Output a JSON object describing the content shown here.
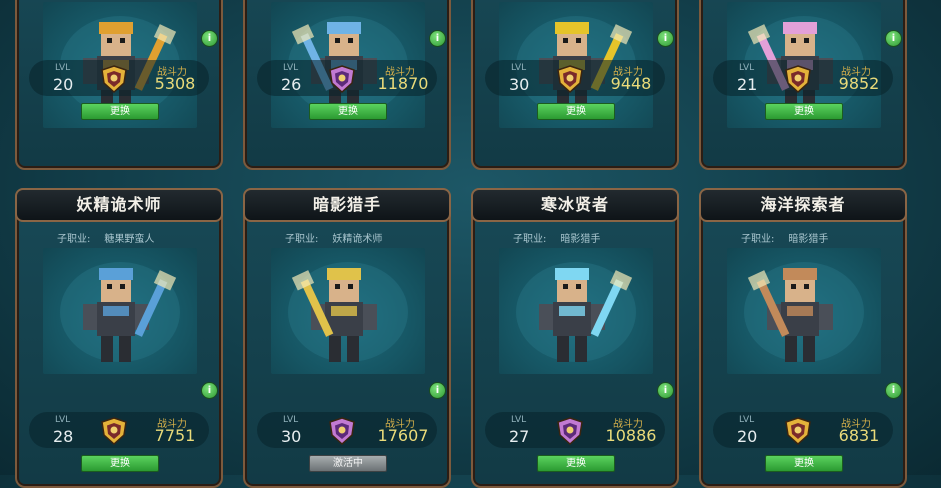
{
  "heroes": [
    {
      "title": "",
      "subclass_label": "",
      "subclass": "",
      "lvl_label": "LVL",
      "level": "20",
      "rank": "gold",
      "cp_label": "战斗力",
      "cp": "5308",
      "button": "更换",
      "button_state": "green",
      "accent": "#e0a030"
    },
    {
      "title": "",
      "subclass_label": "",
      "subclass": "",
      "lvl_label": "LVL",
      "level": "26",
      "rank": "purple",
      "cp_label": "战斗力",
      "cp": "11870",
      "button": "更换",
      "button_state": "green",
      "accent": "#6fb3e6"
    },
    {
      "title": "",
      "subclass_label": "",
      "subclass": "",
      "lvl_label": "LVL",
      "level": "30",
      "rank": "gold",
      "cp_label": "战斗力",
      "cp": "9448",
      "button": "更换",
      "button_state": "green",
      "accent": "#e5c42a"
    },
    {
      "title": "",
      "subclass_label": "",
      "subclass": "",
      "lvl_label": "LVL",
      "level": "21",
      "rank": "gold",
      "cp_label": "战斗力",
      "cp": "9852",
      "button": "更换",
      "button_state": "green",
      "accent": "#e3a0d8"
    },
    {
      "title": "妖精诡术师",
      "subclass_label": "子职业:",
      "subclass": "糖果野蛮人",
      "lvl_label": "LVL",
      "level": "28",
      "rank": "gold",
      "cp_label": "战斗力",
      "cp": "7751",
      "button": "更换",
      "button_state": "green",
      "accent": "#5aa0d8"
    },
    {
      "title": "暗影猎手",
      "subclass_label": "子职业:",
      "subclass": "妖精诡术师",
      "lvl_label": "LVL",
      "level": "30",
      "rank": "purple",
      "cp_label": "战斗力",
      "cp": "17607",
      "button": "激活中",
      "button_state": "grey",
      "accent": "#e0c24a"
    },
    {
      "title": "寒冰贤者",
      "subclass_label": "子职业:",
      "subclass": "暗影猎手",
      "lvl_label": "LVL",
      "level": "27",
      "rank": "purple",
      "cp_label": "战斗力",
      "cp": "10886",
      "button": "更换",
      "button_state": "green",
      "accent": "#7fd7f2"
    },
    {
      "title": "海洋探索者",
      "subclass_label": "子职业:",
      "subclass": "暗影猎手",
      "lvl_label": "LVL",
      "level": "20",
      "rank": "gold",
      "cp_label": "战斗力",
      "cp": "6831",
      "button": "更换",
      "button_state": "green",
      "accent": "#c28a5a"
    }
  ],
  "info_icon_glyph": "i",
  "colors": {
    "button_green": "#3fb844",
    "button_grey": "#8b9193",
    "cp_text": "#eadb7a",
    "frame": "#7c5a3d"
  }
}
